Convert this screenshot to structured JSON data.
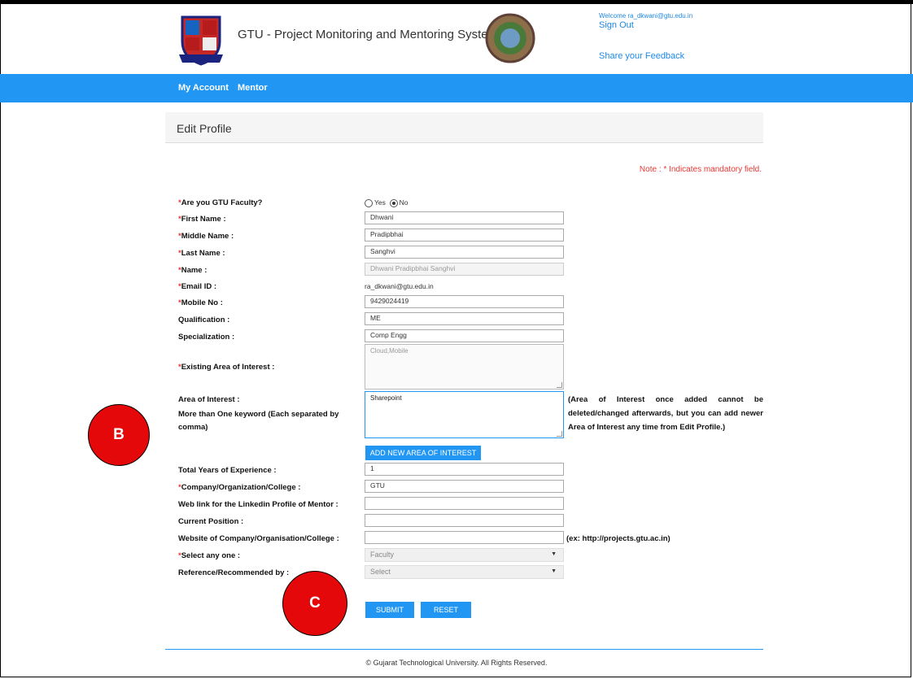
{
  "header": {
    "title": "GTU - Project Monitoring and Mentoring System",
    "welcome": "Welcome ra_dkwani@gtu.edu.in",
    "sign_out": "Sign Out",
    "feedback": "Share your Feedback"
  },
  "nav": {
    "items": [
      "My Account",
      "Mentor"
    ]
  },
  "page": {
    "title": "Edit Profile",
    "note": "Note : * Indicates mandatory field."
  },
  "form": {
    "gtu_faculty": {
      "label": "Are you GTU Faculty?",
      "required": "*",
      "options": [
        "Yes",
        "No"
      ],
      "selected": "No"
    },
    "first_name": {
      "label": "First Name :",
      "required": "*",
      "value": "Dhwani"
    },
    "middle_name": {
      "label": "Middle Name :",
      "required": "*",
      "value": "Pradipbhai"
    },
    "last_name": {
      "label": "Last Name :",
      "required": "*",
      "value": "Sanghvi"
    },
    "name": {
      "label": "Name :",
      "required": "*",
      "value": "Dhwani Pradipbhai Sanghvi"
    },
    "email": {
      "label": "Email ID :",
      "required": "*",
      "value": "ra_dkwani@gtu.edu.in"
    },
    "mobile": {
      "label": "Mobile No :",
      "required": "*",
      "value": "9429024419"
    },
    "qualification": {
      "label": "Qualification :",
      "value": "ME"
    },
    "specialization": {
      "label": "Specialization :",
      "value": "Comp Engg"
    },
    "existing_aoi": {
      "label": "Existing Area of Interest :",
      "required": "*",
      "value": "Cloud,Mobile"
    },
    "aoi": {
      "label_line1": "Area of Interest :",
      "label_line2": "More than One keyword (Each separated by comma)",
      "value": "Sharepoint",
      "note": "(Area of Interest once added cannot be deleted/changed afterwards, but you can add newer Area of Interest any time from Edit Profile.)"
    },
    "add_aoi_button": "ADD NEW AREA OF INTEREST",
    "experience": {
      "label": "Total Years of Experience :",
      "value": "1"
    },
    "company": {
      "label": "Company/Organization/College :",
      "required": "*",
      "value": "GTU"
    },
    "linkedin": {
      "label": "Web link for the Linkedin Profile of Mentor :",
      "value": ""
    },
    "position": {
      "label": "Current Position :",
      "value": ""
    },
    "website": {
      "label": "Website of Company/Organisation/College :",
      "value": "",
      "hint": "(ex: http://projects.gtu.ac.in)"
    },
    "select_one": {
      "label": "Select any one :",
      "required": "*",
      "value": "Faculty"
    },
    "reference": {
      "label": "Reference/Recommended by :",
      "value": "Select"
    },
    "submit": "SUBMIT",
    "reset": "RESET"
  },
  "markers": {
    "b": "B",
    "c": "C"
  },
  "footer": "© Gujarat Technological University. All Rights Reserved.",
  "colors": {
    "primary": "#2196f3",
    "required": "#e53935",
    "marker": "#e4080a"
  }
}
